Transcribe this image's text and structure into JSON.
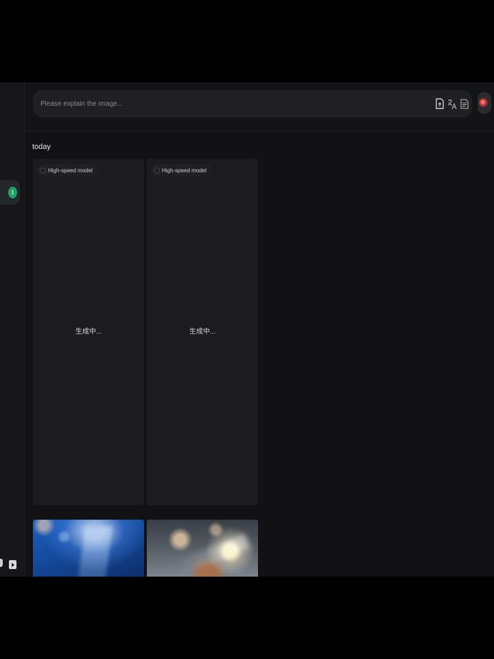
{
  "search": {
    "placeholder": "Please explain the image..."
  },
  "toolbar": {
    "icons": [
      "upload-doc-icon",
      "translate-icon",
      "summary-doc-icon"
    ],
    "avatar": "user-avatar"
  },
  "sidebar": {
    "active_badge": "1",
    "bottom_icons": [
      "apple-icon",
      "play-store-icon"
    ],
    "badge_color": "#1fa463"
  },
  "section": {
    "title": "today"
  },
  "cards": [
    {
      "model": "High-speed model",
      "status": "生成中..."
    },
    {
      "model": "High-speed model",
      "status": "生成中..."
    }
  ],
  "thumbnails": [
    {
      "name": "concert-blue-light-thumbnail"
    },
    {
      "name": "stage-spotlight-thumbnail"
    }
  ]
}
